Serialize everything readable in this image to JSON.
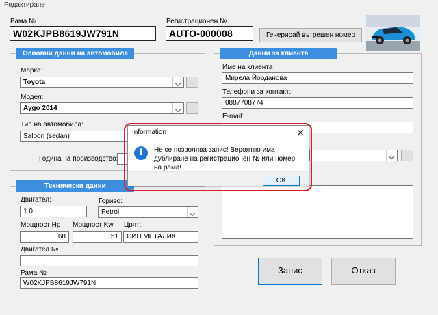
{
  "window": {
    "title": "Редактиране"
  },
  "header": {
    "frame_label": "Рама №",
    "frame_value": "W02KJPB8619JW791N",
    "reg_label": "Регистрационен №",
    "reg_value": "AUTO-000008",
    "generate_button": "Генерирай вътрешен номер"
  },
  "car": {
    "group_title": "Основни данни на автомобила",
    "make_label": "Марка:",
    "make_value": "Toyota",
    "model_label": "Модел:",
    "model_value": "Aygo 2014",
    "type_label": "Тип на автомобила:",
    "type_value": "Saloon (sedan)",
    "year_label": "Година на производство:",
    "dots": "..."
  },
  "tech": {
    "group_title": "Технически данни",
    "engine_label": "Двигател:",
    "engine_value": "1.0",
    "fuel_label": "Гориво:",
    "fuel_value": "Petrol",
    "hp_label": "Мощност Hp",
    "hp_value": "68",
    "kw_label": "Мощност Kw",
    "kw_value": "51",
    "color_label": "Цвят:",
    "color_value": "СИН МЕТАЛИК",
    "engine_no_label": "Двигател №",
    "engine_no_value": "",
    "frame_label": "Рама №",
    "frame_value": "W02KJPB8619JW791N"
  },
  "client": {
    "group_title": "Данни за клиента",
    "name_label": "Име на клиента",
    "name_value": "Мирела Йорданова",
    "phones_label": "Телефони за контакт:",
    "phones_value": "0887708774",
    "email_label": "E-mail:",
    "dots": "..."
  },
  "actions": {
    "save": "Запис",
    "cancel": "Отказ"
  },
  "dialog": {
    "title": "Information",
    "close": "✕",
    "icon": "i",
    "message": "Не се позволява запис! Вероятно има дублиране на регистрационен № или номер на рама!",
    "ok": "OK"
  },
  "colors": {
    "group_header": "#3c8fde",
    "highlight": "#d9202a",
    "info_icon": "#1e73d4"
  }
}
